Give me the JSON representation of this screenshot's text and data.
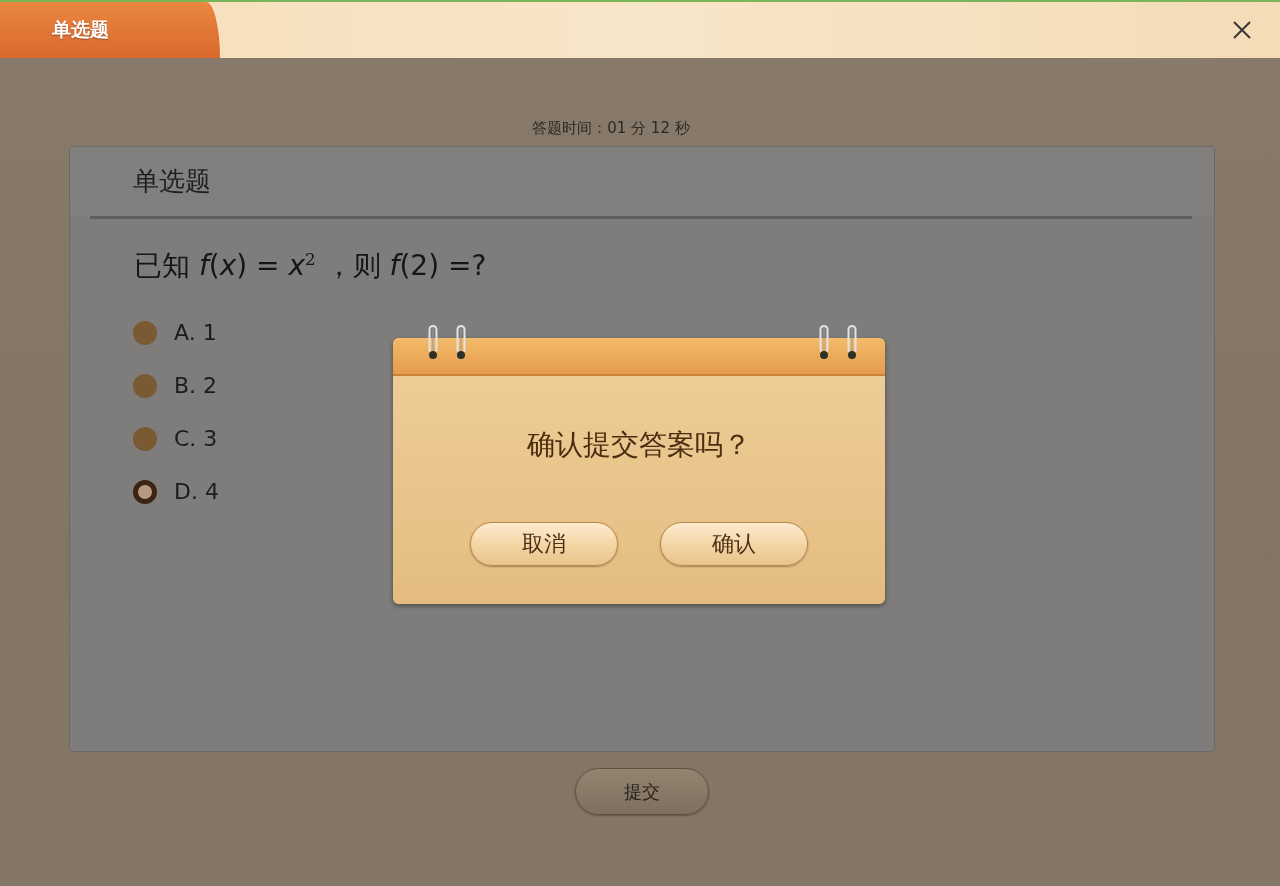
{
  "window": {
    "title": "单选题"
  },
  "timer": "答题时间：01 分 12 秒",
  "question_card": {
    "heading": "单选题",
    "question": "已知 *f*(*x*) = *x*$^{2}$ ，则 *f*(2) =?",
    "options": [
      {
        "label": "A. 1",
        "selected": false
      },
      {
        "label": "B. 2",
        "selected": false
      },
      {
        "label": "C. 3",
        "selected": false
      },
      {
        "label": "D. 4",
        "selected": true
      }
    ]
  },
  "submit_button": "提交",
  "dialog": {
    "message": "确认提交答案吗？",
    "buttons": [
      "取消",
      "确认"
    ]
  }
}
